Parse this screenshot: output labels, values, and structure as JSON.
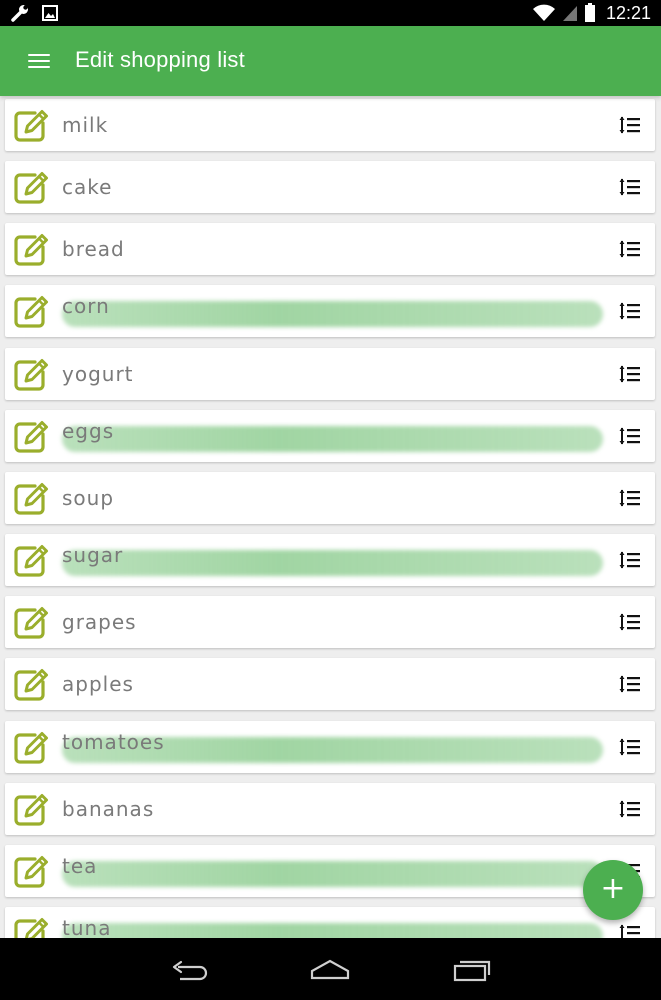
{
  "status_bar": {
    "time": "12:21",
    "left_icons": [
      "wrench-icon",
      "image-icon"
    ],
    "right_icons": [
      "wifi-icon",
      "signal-icon",
      "battery-icon"
    ]
  },
  "app_bar": {
    "title": "Edit shopping list",
    "background": "#4caf50"
  },
  "list": {
    "items": [
      {
        "label": "milk",
        "crossed": false
      },
      {
        "label": "cake",
        "crossed": false
      },
      {
        "label": "bread",
        "crossed": false
      },
      {
        "label": "corn",
        "crossed": true
      },
      {
        "label": "yogurt",
        "crossed": false
      },
      {
        "label": "eggs",
        "crossed": true
      },
      {
        "label": "soup",
        "crossed": false
      },
      {
        "label": "sugar",
        "crossed": true
      },
      {
        "label": "grapes",
        "crossed": false
      },
      {
        "label": "apples",
        "crossed": false
      },
      {
        "label": "tomatoes",
        "crossed": true
      },
      {
        "label": "bananas",
        "crossed": false
      },
      {
        "label": "tea",
        "crossed": true
      },
      {
        "label": "tuna",
        "crossed": true
      }
    ]
  },
  "fab": {
    "label": "+",
    "icon": "add-icon"
  },
  "colors": {
    "accent": "#4caf50",
    "edit_icon": "#9aae2c",
    "item_text": "#7a7a7a",
    "highlight": "#81c784"
  },
  "nav_bar": {
    "buttons": [
      "back-icon",
      "home-icon",
      "recents-icon"
    ]
  }
}
